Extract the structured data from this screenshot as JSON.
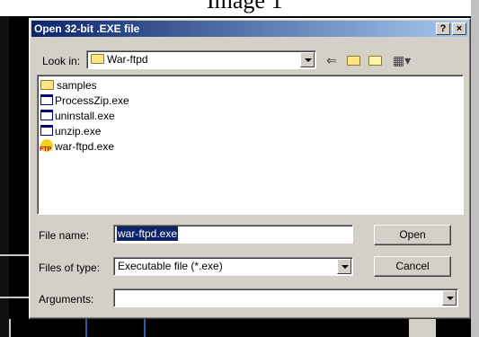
{
  "background": {
    "caption": "Image 1"
  },
  "dialog": {
    "title": "Open 32-bit .EXE file",
    "help_btn": "?",
    "close_btn": "×"
  },
  "lookin": {
    "label": "Look in:",
    "value": "War-ftpd",
    "icon": "folder-icon"
  },
  "toolbar": {
    "back_icon": "back-arrow-icon",
    "up_icon": "up-folder-icon",
    "newfolder_icon": "new-folder-icon",
    "views_icon": "views-menu-icon",
    "back": "⇐",
    "views": "▦▾"
  },
  "files": [
    {
      "name": "samples",
      "icon": "folder-icon"
    },
    {
      "name": "ProcessZip.exe",
      "icon": "exe-icon"
    },
    {
      "name": "uninstall.exe",
      "icon": "exe-icon"
    },
    {
      "name": "unzip.exe",
      "icon": "exe-icon"
    },
    {
      "name": "war-ftpd.exe",
      "icon": "ftp-icon"
    }
  ],
  "filename": {
    "label": "File name:",
    "value": "war-ftpd.exe"
  },
  "filetype": {
    "label": "Files of type:",
    "value": "Executable file (*.exe)"
  },
  "arguments": {
    "label": "Arguments:",
    "value": ""
  },
  "buttons": {
    "open": "Open",
    "cancel": "Cancel"
  },
  "colors": {
    "title_start": "#0a246a",
    "title_end": "#a6caf0",
    "face": "#d4d0c8",
    "selection": "#0a246a"
  }
}
